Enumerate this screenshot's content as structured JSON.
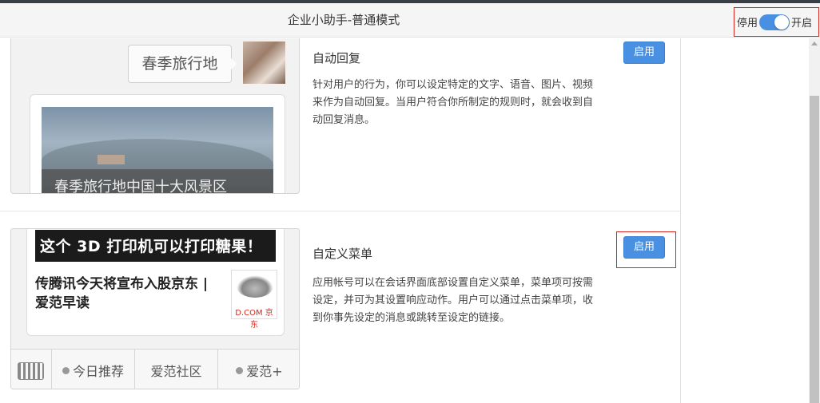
{
  "header": {
    "title": "企业小助手-普通模式",
    "toggle": {
      "off_label": "停用",
      "on_label": "开启",
      "state": "on"
    }
  },
  "colors": {
    "accent": "#4a90e2",
    "highlight": "#d9261c"
  },
  "features": [
    {
      "title": "自动回复",
      "description": "针对用户的行为，你可以设定特定的文字、语音、图片、视频来作为自动回复。当用户符合你所制定的规则时，就会收到自动回复消息。",
      "button": "启用",
      "preview": {
        "bubble": "春季旅行地",
        "caption": "春季旅行地中国十大风景区"
      }
    },
    {
      "title": "自定义菜单",
      "description": "应用帐号可以在会话界面底部设置自定义菜单，菜单项可按需设定，并可为其设置响应动作。用户可以通过点击菜单项，收到你事先设定的消息或跳转至设定的链接。",
      "button": "启用",
      "preview": {
        "banner": "这个 3D 打印机可以打印糖果！",
        "news_title": "传腾讯今天将宣布入股京东 | 爱范早读",
        "thumb_logo": "D.COM 京东",
        "menu": [
          "今日推荐",
          "爱范社区",
          "爱范+"
        ]
      }
    }
  ]
}
